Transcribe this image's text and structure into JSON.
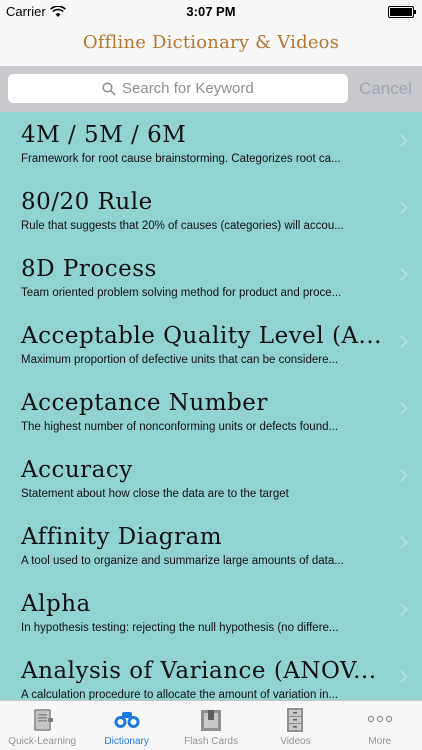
{
  "status": {
    "carrier": "Carrier",
    "time": "3:07 PM"
  },
  "nav": {
    "title": "Offline Dictionary & Videos"
  },
  "search": {
    "placeholder": "Search for Keyword",
    "cancel": "Cancel"
  },
  "items": [
    {
      "title": "4M / 5M / 6M",
      "subtitle": "Framework for root cause brainstorming. Categorizes root ca..."
    },
    {
      "title": "80/20 Rule",
      "subtitle": "Rule that suggests that 20% of causes (categories) will accou..."
    },
    {
      "title": "8D Process",
      "subtitle": "Team oriented problem solving method for product and proce..."
    },
    {
      "title": "Acceptable Quality Level (A...",
      "subtitle": "Maximum proportion of defective units that can be considere..."
    },
    {
      "title": "Acceptance Number",
      "subtitle": "The highest number of nonconforming units or defects found..."
    },
    {
      "title": "Accuracy",
      "subtitle": "Statement about how close the data are to the target"
    },
    {
      "title": "Affinity Diagram",
      "subtitle": "A tool used to organize and summarize large amounts of data..."
    },
    {
      "title": "Alpha",
      "subtitle": "In hypothesis testing: rejecting the null hypothesis (no differe..."
    },
    {
      "title": "Analysis of Variance (ANOV...",
      "subtitle": "A calculation procedure to allocate the amount of variation in..."
    }
  ],
  "tabs": [
    {
      "label": "Quick-Learning",
      "icon": "binder-icon"
    },
    {
      "label": "Dictionary",
      "icon": "binoculars-icon"
    },
    {
      "label": "Flash Cards",
      "icon": "flashcard-icon"
    },
    {
      "label": "Videos",
      "icon": "cabinet-icon"
    },
    {
      "label": "More",
      "icon": "more-icon"
    }
  ],
  "colors": {
    "accent": "#1f7ae0",
    "list_bg": "#91d3d1",
    "title": "#b5762e"
  }
}
